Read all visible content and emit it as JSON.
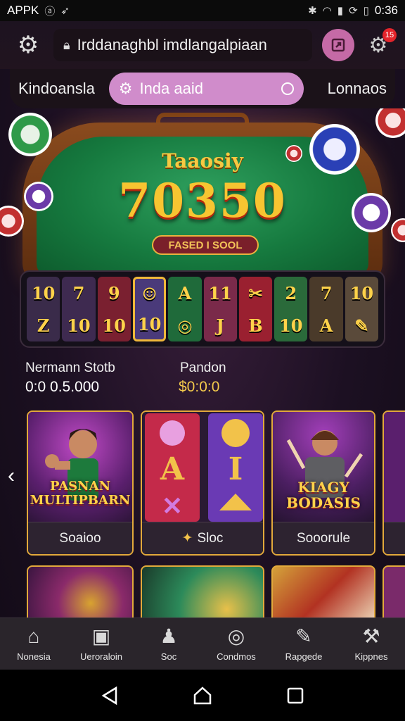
{
  "status_bar": {
    "app_label": "APPK",
    "time": "0:36"
  },
  "header": {
    "url": "Irddanaghbl imdlangalpiaan",
    "settings_badge": "15"
  },
  "nav": {
    "left_label": "Kindoansla",
    "pill_label": "Inda aaid",
    "right_label": "Lonnaos"
  },
  "hero": {
    "title": "Taaosiy",
    "number": "70350",
    "button_label": "FASED I SOOL"
  },
  "reels": {
    "symbols": [
      [
        "10",
        "Z"
      ],
      [
        "7",
        "10"
      ],
      [
        "9",
        "10"
      ],
      [
        "☺",
        "10"
      ],
      [
        "A",
        "◎"
      ],
      [
        "11",
        "J"
      ],
      [
        "✂",
        "B"
      ],
      [
        "2",
        "10"
      ],
      [
        "7",
        "A"
      ],
      [
        "10",
        "✎"
      ]
    ]
  },
  "stats": {
    "left_label": "Nermann Stotb",
    "left_value": "0:0 0.5.000",
    "right_label": "Pandon",
    "right_value": "$0:0:0"
  },
  "cards": [
    {
      "art_title": "PASNAN MULTIPBARN",
      "caption": "Soaioo"
    },
    {
      "art_title": "",
      "caption": "Sloc"
    },
    {
      "art_title": "KIAGY BODASIS",
      "caption": "Sooorule"
    }
  ],
  "bottom_nav": [
    {
      "icon": "home-icon",
      "label": "Nonesia"
    },
    {
      "icon": "briefcase-icon",
      "label": "Ueroraloin"
    },
    {
      "icon": "microphone-icon",
      "label": "Soc"
    },
    {
      "icon": "chip-icon",
      "label": "Condmos"
    },
    {
      "icon": "brush-icon",
      "label": "Rapgede"
    },
    {
      "icon": "tools-icon",
      "label": "Kippnes"
    }
  ],
  "colors": {
    "accent_pink": "#c56aa6",
    "pill_pink": "#d08ccb",
    "gold": "#f2c94c",
    "felt_green": "#167a3f"
  }
}
